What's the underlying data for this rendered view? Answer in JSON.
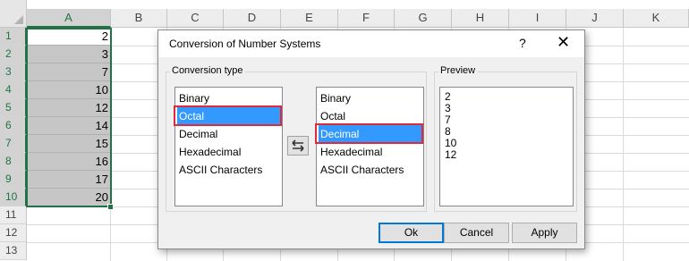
{
  "sheet": {
    "columns": [
      "A",
      "B",
      "C",
      "D",
      "E",
      "F",
      "G",
      "H",
      "I",
      "J",
      "K"
    ],
    "rows": [
      "1",
      "2",
      "3",
      "4",
      "5",
      "6",
      "7",
      "8",
      "9",
      "10",
      "11",
      "12",
      "13"
    ],
    "column_a_values": [
      "2",
      "3",
      "7",
      "10",
      "12",
      "14",
      "15",
      "16",
      "17",
      "20"
    ],
    "accent": "#217346"
  },
  "dialog": {
    "title": "Conversion of Number Systems",
    "help_label": "?",
    "close_label": "✕",
    "conversion_type_label": "Conversion type",
    "preview_label": "Preview",
    "from_list": [
      "Binary",
      "Octal",
      "Decimal",
      "Hexadecimal",
      "ASCII Characters"
    ],
    "from_selected": "Octal",
    "to_list": [
      "Binary",
      "Octal",
      "Decimal",
      "Hexadecimal",
      "ASCII Characters"
    ],
    "to_selected": "Decimal",
    "preview_lines": [
      "2",
      "3",
      "7",
      "8",
      "10",
      "12"
    ],
    "buttons": {
      "ok": "Ok",
      "cancel": "Cancel",
      "apply": "Apply"
    },
    "selection_color": "#3399ff",
    "highlight_color": "#e0293a"
  }
}
